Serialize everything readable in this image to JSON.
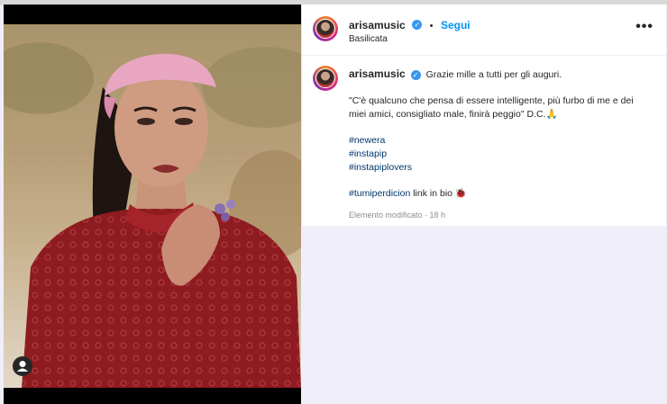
{
  "post": {
    "username": "arisamusic",
    "follow_label": "Segui",
    "separator": "•",
    "location": "Basilicata",
    "more_label": "•••",
    "caption_line1": "Grazie mille a tutti per gli auguri.",
    "caption_quote": "\"C'è qualcuno che pensa di essere intelligente, più furbo di me e dei miei amici, consigliato male, finirà peggio\" D.C.🙏",
    "hashtags": [
      "#newera",
      "#instapip",
      "#instapiplovers"
    ],
    "last_tag": "#tumiperdicion",
    "last_text": " link in bio 🐞",
    "meta": "Elemento modificato · 18 h"
  }
}
